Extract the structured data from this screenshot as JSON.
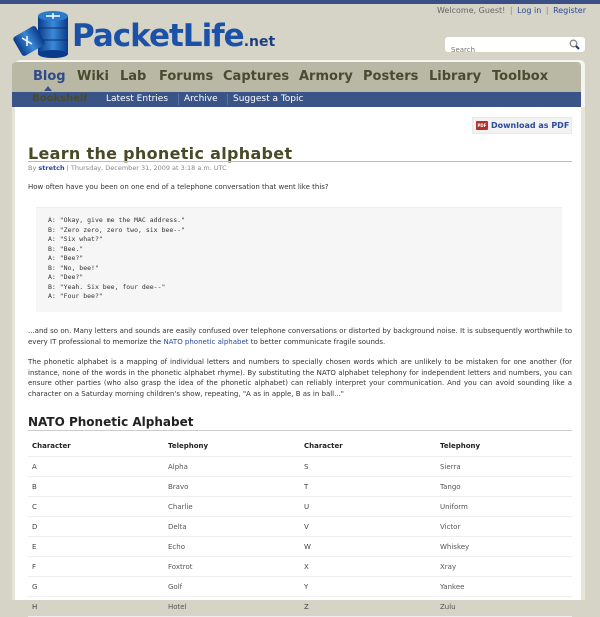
{
  "header": {
    "welcome": "Welcome, Guest!",
    "login": "Log in",
    "register": "Register",
    "logo_main": "PacketLife",
    "logo_tld": ".net",
    "search_placeholder": "Search",
    "search_icon": "magnifier-icon"
  },
  "nav": {
    "items": [
      "Blog",
      "Wiki",
      "Lab",
      "Forums",
      "Captures",
      "Armory",
      "Posters",
      "Library",
      "Toolbox"
    ],
    "active": "Blog",
    "section": "Bookshelf",
    "sub_items": [
      "Latest Entries",
      "Archive",
      "Suggest a Topic"
    ]
  },
  "pdf_button": {
    "label": "Download as PDF",
    "icon": "pdf-icon"
  },
  "article": {
    "title": "Learn the phonetic alphabet",
    "by": "By",
    "author": "stretch",
    "date": "Thursday, December 31, 2009 at 3:18 a.m. UTC",
    "intro": "How often have you been on one end of a telephone conversation that went like this?",
    "dialogue": [
      "A: \"Okay, give me the MAC address.\"",
      "B: \"Zero zero, zero two, six bee--\"",
      "A: \"Six what?\"",
      "B: \"Bee.\"",
      "A: \"Bee?\"",
      "B: \"No, bee!\"",
      "A: \"Dee?\"",
      "B: \"Yeah. Six bee, four dee--\"",
      "A: \"Four bee?\""
    ],
    "para1_before": "...and so on. Many letters and sounds are easily confused over telephone conversations or distorted by background noise. It is subsequently worthwhile to every IT professional to memorize the ",
    "para1_link": "NATO phonetic alphabet",
    "para1_after": " to better communicate fragile sounds.",
    "para2": "The phonetic alphabet is a mapping of individual letters and numbers to specially chosen words which are unlikely to be mistaken for one another (for instance, none of the words in the phonetic alphabet rhyme). By substituting the NATO alphabet telephony for independent letters and numbers, you can ensure other parties (who also grasp the idea of the phonetic alphabet) can reliably interpret your communication. And you can avoid sounding like a character on a Saturday morning children's show, repeating, \"A as in apple, B as in ball...\"",
    "table_heading": "NATO Phonetic Alphabet",
    "table": {
      "headers": [
        "Character",
        "Telephony",
        "Character",
        "Telephony"
      ],
      "rows": [
        [
          "A",
          "Alpha",
          "S",
          "Sierra"
        ],
        [
          "B",
          "Bravo",
          "T",
          "Tango"
        ],
        [
          "C",
          "Charlie",
          "U",
          "Uniform"
        ],
        [
          "D",
          "Delta",
          "V",
          "Victor"
        ],
        [
          "E",
          "Echo",
          "W",
          "Whiskey"
        ],
        [
          "F",
          "Foxtrot",
          "X",
          "Xray"
        ],
        [
          "G",
          "Golf",
          "Y",
          "Yankee"
        ],
        [
          "H",
          "Hotel",
          "Z",
          "Zulu"
        ]
      ]
    }
  }
}
